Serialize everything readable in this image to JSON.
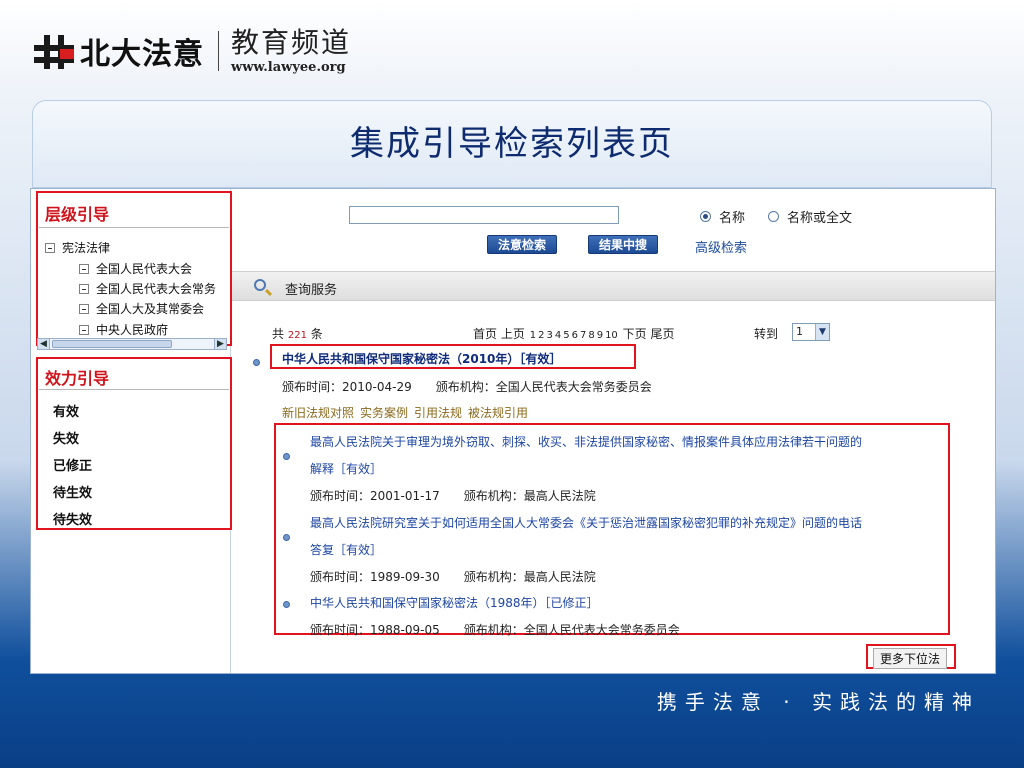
{
  "header": {
    "brand": "北大法意",
    "channel": "教育频道",
    "url": "www.lawyee.org"
  },
  "slide_title": "集成引导检索列表页",
  "sidebar": {
    "level_title": "层级引导",
    "tree": [
      "宪法法律",
      "全国人民代表大会",
      "全国人民代表大会常务",
      "全国人大及其常委会",
      "中央人民政府"
    ],
    "effect_title": "效力引导",
    "effect_items": [
      "有效",
      "失效",
      "已修正",
      "待生效",
      "待失效"
    ]
  },
  "search": {
    "input_value": "",
    "radio_name": "名称",
    "radio_fulltext": "名称或全文",
    "btn_search": "法意检索",
    "btn_within": "结果中搜",
    "advanced": "高级检索"
  },
  "query_bar": {
    "label": "查询服务"
  },
  "pager": {
    "prefix": "共",
    "total": "221",
    "suffix": "条",
    "first": "首页",
    "prev": "上页",
    "pages": [
      "1",
      "2",
      "3",
      "4",
      "5",
      "6",
      "7",
      "8",
      "9",
      "10"
    ],
    "next": "下页",
    "last": "尾页",
    "goto": "转到",
    "current": "1"
  },
  "main_result": {
    "title": "中华人民共和国保守国家秘密法（2010年）［有效］",
    "meta": "颁布时间：2010-04-29　　颁布机构：全国人民代表大会常务委员会",
    "links": [
      "新旧法规对照",
      "实务案例",
      "引用法规",
      "被法规引用"
    ]
  },
  "sub_results": [
    {
      "title_line1": "最高人民法院关于审理为境外窃取、刺探、收买、非法提供国家秘密、情报案件具体应用法律若干问题的",
      "title_line2": "解释［有效］",
      "meta": "颁布时间：2001-01-17　　颁布机构：最高人民法院"
    },
    {
      "title_line1": "最高人民法院研究室关于如何适用全国人大常委会《关于惩治泄露国家秘密犯罪的补充规定》问题的电话",
      "title_line2": "答复［有效］",
      "meta": "颁布时间：1989-09-30　　颁布机构：最高人民法院"
    },
    {
      "title_line1": "中华人民共和国保守国家秘密法（1988年）［已修正］",
      "title_line2": "",
      "meta": "颁布时间：1988-09-05　　颁布机构：全国人民代表大会常务委员会"
    }
  ],
  "more_button": "更多下位法",
  "slogan": "携手法意 · 实践法的精神"
}
